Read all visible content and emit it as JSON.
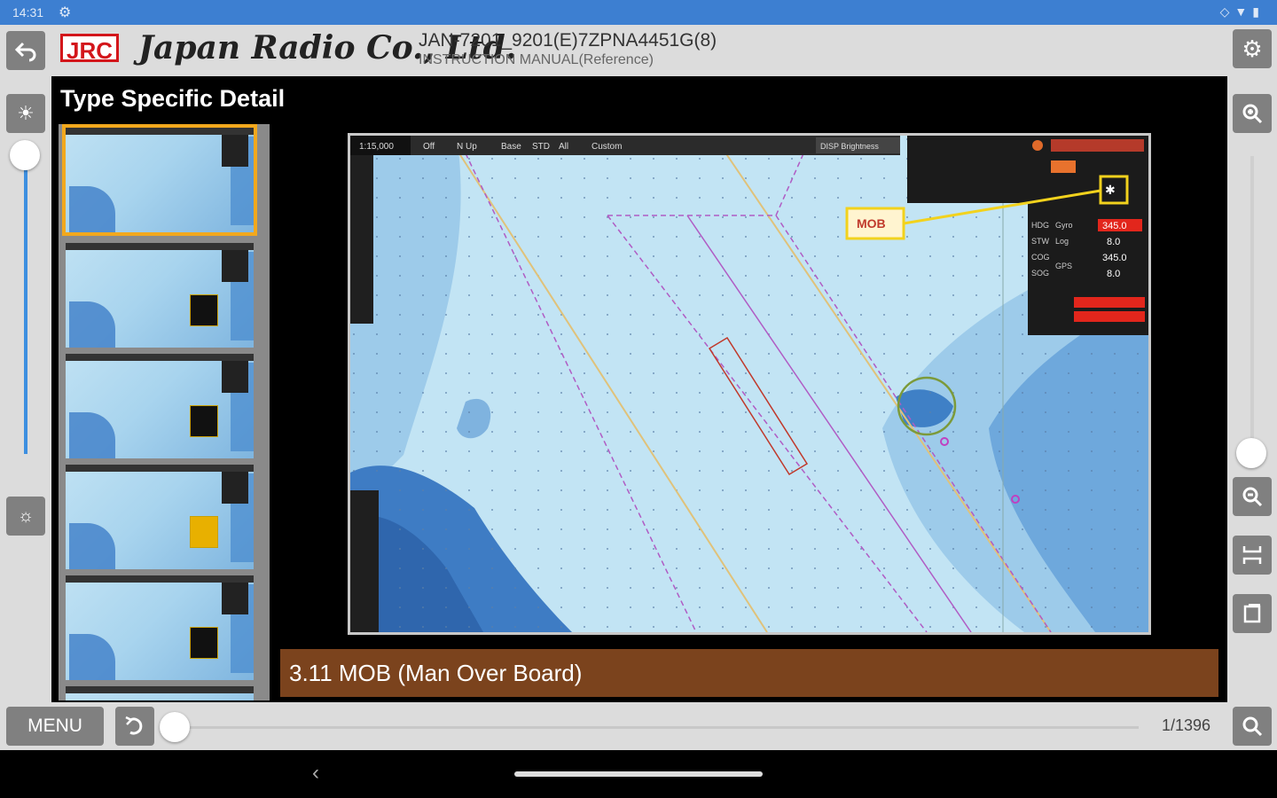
{
  "status": {
    "time": "14:31"
  },
  "header": {
    "logo_abbr": "JRC",
    "logo_name": "Japan Radio Co., Ltd.",
    "doc_title": "JAN-7201_9201(E)7ZPNA4451G(8)",
    "doc_subtitle": "INSTRUCTION MANUAL(Reference)"
  },
  "main": {
    "heading": "Type Specific Detail",
    "caption": "3.11 MOB (Man Over Board)",
    "map": {
      "scale": "1:15,000",
      "menu_items": [
        "Off",
        "N Up",
        "Base",
        "STD",
        "All",
        "Custom"
      ],
      "brightness": "DISP Brightness",
      "mob_label": "MOB",
      "data_rows": [
        {
          "label": "HDG",
          "src": "Gyro",
          "value": "345.0"
        },
        {
          "label": "STW",
          "src": "Log",
          "value": "8.0"
        },
        {
          "label": "COG",
          "src": "GPS",
          "value": "345.0"
        },
        {
          "label": "SOG",
          "src": "",
          "value": "8.0"
        }
      ]
    }
  },
  "footer": {
    "menu_label": "MENU",
    "page_indicator": "1/1396"
  }
}
